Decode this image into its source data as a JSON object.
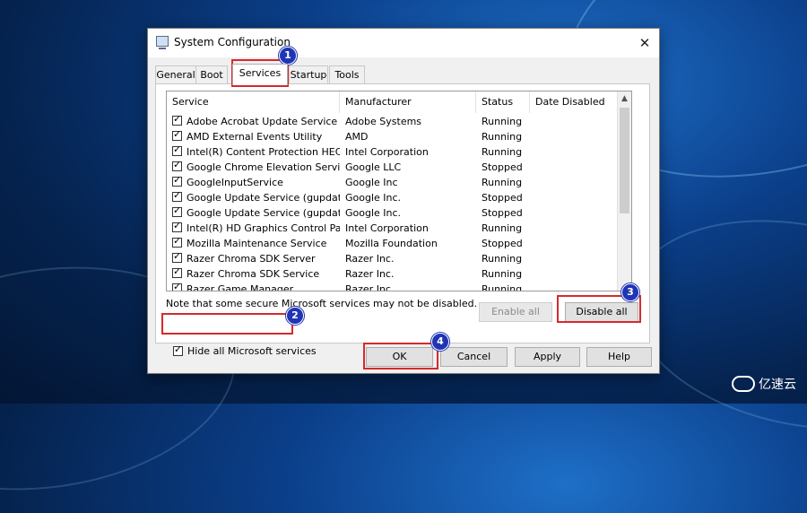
{
  "window": {
    "title": "System Configuration"
  },
  "tabs": [
    "General",
    "Boot",
    "Services",
    "Startup",
    "Tools"
  ],
  "columns": [
    "Service",
    "Manufacturer",
    "Status",
    "Date Disabled"
  ],
  "services": [
    {
      "name": "Adobe Acrobat Update Service",
      "manufacturer": "Adobe Systems",
      "status": "Running"
    },
    {
      "name": "AMD External Events Utility",
      "manufacturer": "AMD",
      "status": "Running"
    },
    {
      "name": "Intel(R) Content Protection HEC...",
      "manufacturer": "Intel Corporation",
      "status": "Running"
    },
    {
      "name": "Google Chrome Elevation Service",
      "manufacturer": "Google LLC",
      "status": "Stopped"
    },
    {
      "name": "GoogleInputService",
      "manufacturer": "Google Inc",
      "status": "Running"
    },
    {
      "name": "Google Update Service (gupdate)",
      "manufacturer": "Google Inc.",
      "status": "Stopped"
    },
    {
      "name": "Google Update Service (gupdatem)",
      "manufacturer": "Google Inc.",
      "status": "Stopped"
    },
    {
      "name": "Intel(R) HD Graphics Control Pa...",
      "manufacturer": "Intel Corporation",
      "status": "Running"
    },
    {
      "name": "Mozilla Maintenance Service",
      "manufacturer": "Mozilla Foundation",
      "status": "Stopped"
    },
    {
      "name": "Razer Chroma SDK Server",
      "manufacturer": "Razer Inc.",
      "status": "Running"
    },
    {
      "name": "Razer Chroma SDK Service",
      "manufacturer": "Razer Inc.",
      "status": "Running"
    },
    {
      "name": "Razer Game Manager",
      "manufacturer": "Razer Inc",
      "status": "Running"
    }
  ],
  "note": "Note that some secure Microsoft services may not be disabled.",
  "buttons": {
    "enable_all": "Enable all",
    "disable_all": "Disable all",
    "ok": "OK",
    "cancel": "Cancel",
    "apply": "Apply",
    "help": "Help"
  },
  "hide_ms_label": "Hide all Microsoft services",
  "steps": [
    "1",
    "2",
    "3",
    "4"
  ],
  "brand": "亿速云",
  "colors": {
    "highlight": "#d62a2a",
    "badge": "#1f35b5"
  }
}
